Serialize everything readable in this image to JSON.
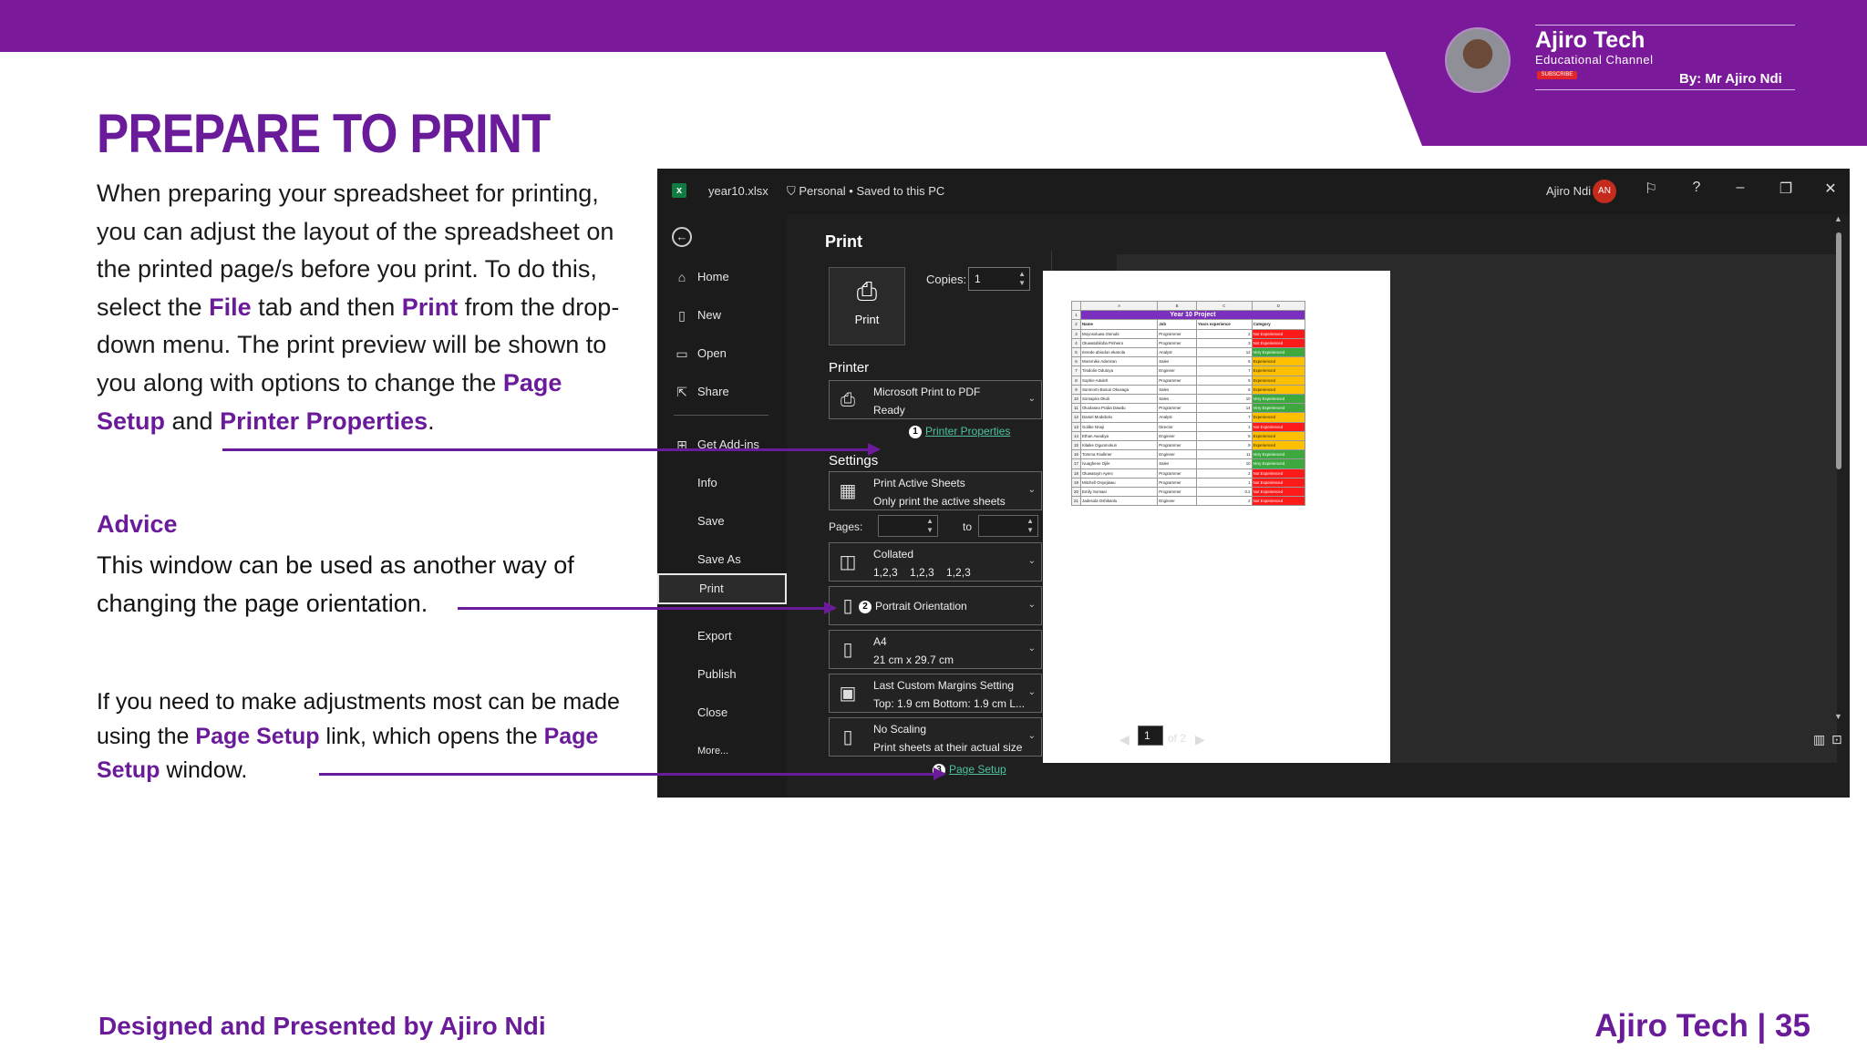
{
  "brand": {
    "name": "Ajiro Tech",
    "subtitle": "Educational Channel",
    "subscribe": "SUBSCRIBE",
    "by": "By: Mr Ajiro Ndi"
  },
  "slide": {
    "title": "PREPARE TO PRINT",
    "intro": {
      "t1": "When preparing your spreadsheet for printing, you can adjust the layout of the spreadsheet on the printed page/s before you print. To do this, select the ",
      "file": "File",
      "t2": " tab and then ",
      "print": "Print",
      "t3": " from the drop-down menu. The print preview will be shown to you along with options to change the ",
      "page_setup": "Page Setup",
      "t4": " and ",
      "printer_properties": "Printer Properties",
      "t5": "."
    },
    "advice_heading": "Advice",
    "advice_body": "This window can be used as another way of changing the page orientation.",
    "adjust": {
      "t1": "If you need to make adjustments most can be made using the ",
      "page_setup": "Page Setup",
      "t2": " link, which opens the ",
      "page_setup2": "Page Setup",
      "t3": " window."
    },
    "footer_left": "Designed and Presented by Ajiro Ndi",
    "footer_right": "Ajiro Tech | 35"
  },
  "excel": {
    "file_name": "year10.xlsx",
    "status": "Personal • Saved to this PC",
    "user": "Ajiro Ndi",
    "user_initials": "AN",
    "nav": [
      "Home",
      "New",
      "Open",
      "Share",
      "Get Add-ins",
      "Info",
      "Save",
      "Save As",
      "Print",
      "Export",
      "Publish",
      "Close",
      "More..."
    ],
    "print_title": "Print",
    "print_button": "Print",
    "copies_label": "Copies:",
    "copies_value": "1",
    "printer_heading": "Printer",
    "printer_name": "Microsoft Print to PDF",
    "printer_status": "Ready",
    "printer_properties_link": "Printer Properties",
    "settings_heading": "Settings",
    "settings": {
      "sheets_main": "Print Active Sheets",
      "sheets_sub": "Only print the active sheets",
      "pages_label": "Pages:",
      "to_label": "to",
      "collated_main": "Collated",
      "collated_sub": "1,2,3    1,2,3    1,2,3",
      "orientation": "Portrait Orientation",
      "paper_main": "A4",
      "paper_sub": "21 cm x 29.7 cm",
      "margins_main": "Last Custom Margins Setting",
      "margins_sub": "Top: 1.9 cm Bottom: 1.9 cm L...",
      "scaling_main": "No Scaling",
      "scaling_sub": "Print sheets at their actual size"
    },
    "page_setup_link": "Page Setup",
    "badges": [
      "1",
      "2",
      "3"
    ],
    "page_current": "1",
    "page_of": "of 2"
  },
  "sheet": {
    "col_headers": [
      "A",
      "B",
      "C",
      "D"
    ],
    "title": "Year 10 Project",
    "headers": [
      "Name",
      "Job",
      "Years experience",
      "Category"
    ],
    "rows": [
      [
        "Moyosoluwa Osinubi",
        "Programmer",
        "2",
        "Not Experienced",
        "red"
      ],
      [
        "Oluwatobiloba Pinheiro",
        "Programmer",
        "3",
        "Not Experienced",
        "red"
      ],
      [
        "Iterede abiodun ekanola",
        "Analyst",
        "12",
        "Very Experienced",
        "green"
      ],
      [
        "Moremike Adeniran",
        "Sales",
        "5",
        "Experienced",
        "amber"
      ],
      [
        "Tinidolin Odutoya",
        "Engineer",
        "7",
        "Experienced",
        "amber"
      ],
      [
        "Sophie Aduleh",
        "Programmer",
        "9",
        "Experienced",
        "amber"
      ],
      [
        "Sunmomi Bosun Okusaga",
        "Sales",
        "6",
        "Experienced",
        "amber"
      ],
      [
        "Somapira Okoli",
        "Sales",
        "10",
        "Very Experienced",
        "green"
      ],
      [
        "Oluolasea Praba Dawdu",
        "Programmer",
        "14",
        "Very Experienced",
        "green"
      ],
      [
        "Daniel Modebolu",
        "Analyst",
        "7",
        "Experienced",
        "amber"
      ],
      [
        "Golibe Nnaji",
        "Director",
        "1",
        "Not Experienced",
        "red"
      ],
      [
        "Ethan Awodiya",
        "Engineer",
        "6",
        "Experienced",
        "amber"
      ],
      [
        "Kilaike Ogunmokun",
        "Programmer",
        "9",
        "Experienced",
        "amber"
      ],
      [
        "Tomma Faulkner",
        "Engineer",
        "11",
        "Very Experienced",
        "green"
      ],
      [
        "Ivuaghene Ojile",
        "Sales",
        "10",
        "Very Experienced",
        "green"
      ],
      [
        "Oluwatoyin Ayeni",
        "Programmer",
        "2",
        "Not Experienced",
        "red"
      ],
      [
        "Mitchell Onyejiawu",
        "Programmer",
        "1",
        "Not Experienced",
        "red"
      ],
      [
        "Emily Somaei",
        "Programmer",
        "0.2",
        "Not Experienced",
        "red"
      ],
      [
        "Jadesola Oshikanlu",
        "Engineer",
        "2",
        "Not Experienced",
        "red"
      ]
    ]
  },
  "colors": {
    "brand_purple": "#7a1a9a",
    "text_purple": "#6a1b9a",
    "excel_green": "#107c41"
  }
}
